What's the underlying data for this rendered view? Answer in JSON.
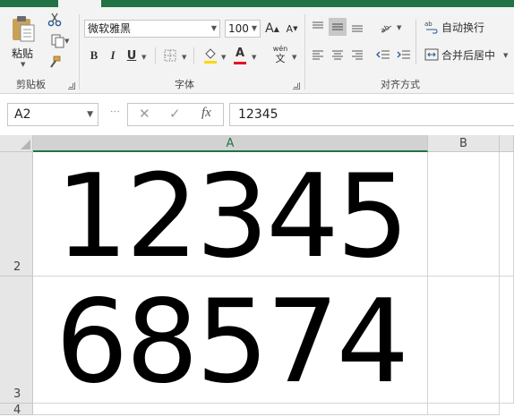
{
  "ribbon": {
    "clipboard": {
      "group_label": "剪贴板",
      "paste_label": "粘贴",
      "cut_icon": "scissors-icon",
      "copy_icon": "copy-icon",
      "format_painter_icon": "paintbrush-icon"
    },
    "font": {
      "group_label": "字体",
      "font_name": "微软雅黑",
      "font_size": "100",
      "grow_label": "A",
      "shrink_label": "A",
      "bold_label": "B",
      "italic_label": "I",
      "underline_label": "U",
      "font_color_label": "A",
      "phonetic_label": "wén",
      "phonetic_sub": "文",
      "font_color": "#e81123",
      "fill_color": "#ffd700"
    },
    "alignment": {
      "group_label": "对齐方式",
      "wrap_text_label": "自动换行",
      "merge_center_label": "合并后居中",
      "orientation_label": "ab"
    }
  },
  "formula_bar": {
    "name_box": "A2",
    "cancel_glyph": "✕",
    "enter_glyph": "✓",
    "fx_label": "fx",
    "content": "12345"
  },
  "grid": {
    "columns": [
      "A",
      "B"
    ],
    "selected_column": "A",
    "rows": [
      {
        "row_label": "2",
        "a_value": "12345"
      },
      {
        "row_label": "3",
        "a_value": "68574"
      },
      {
        "row_label": "4",
        "a_value": ""
      }
    ]
  },
  "colors": {
    "accent": "#217346",
    "ribbon_bg": "#f3f3f3",
    "header_bg": "#e6e6e6"
  }
}
